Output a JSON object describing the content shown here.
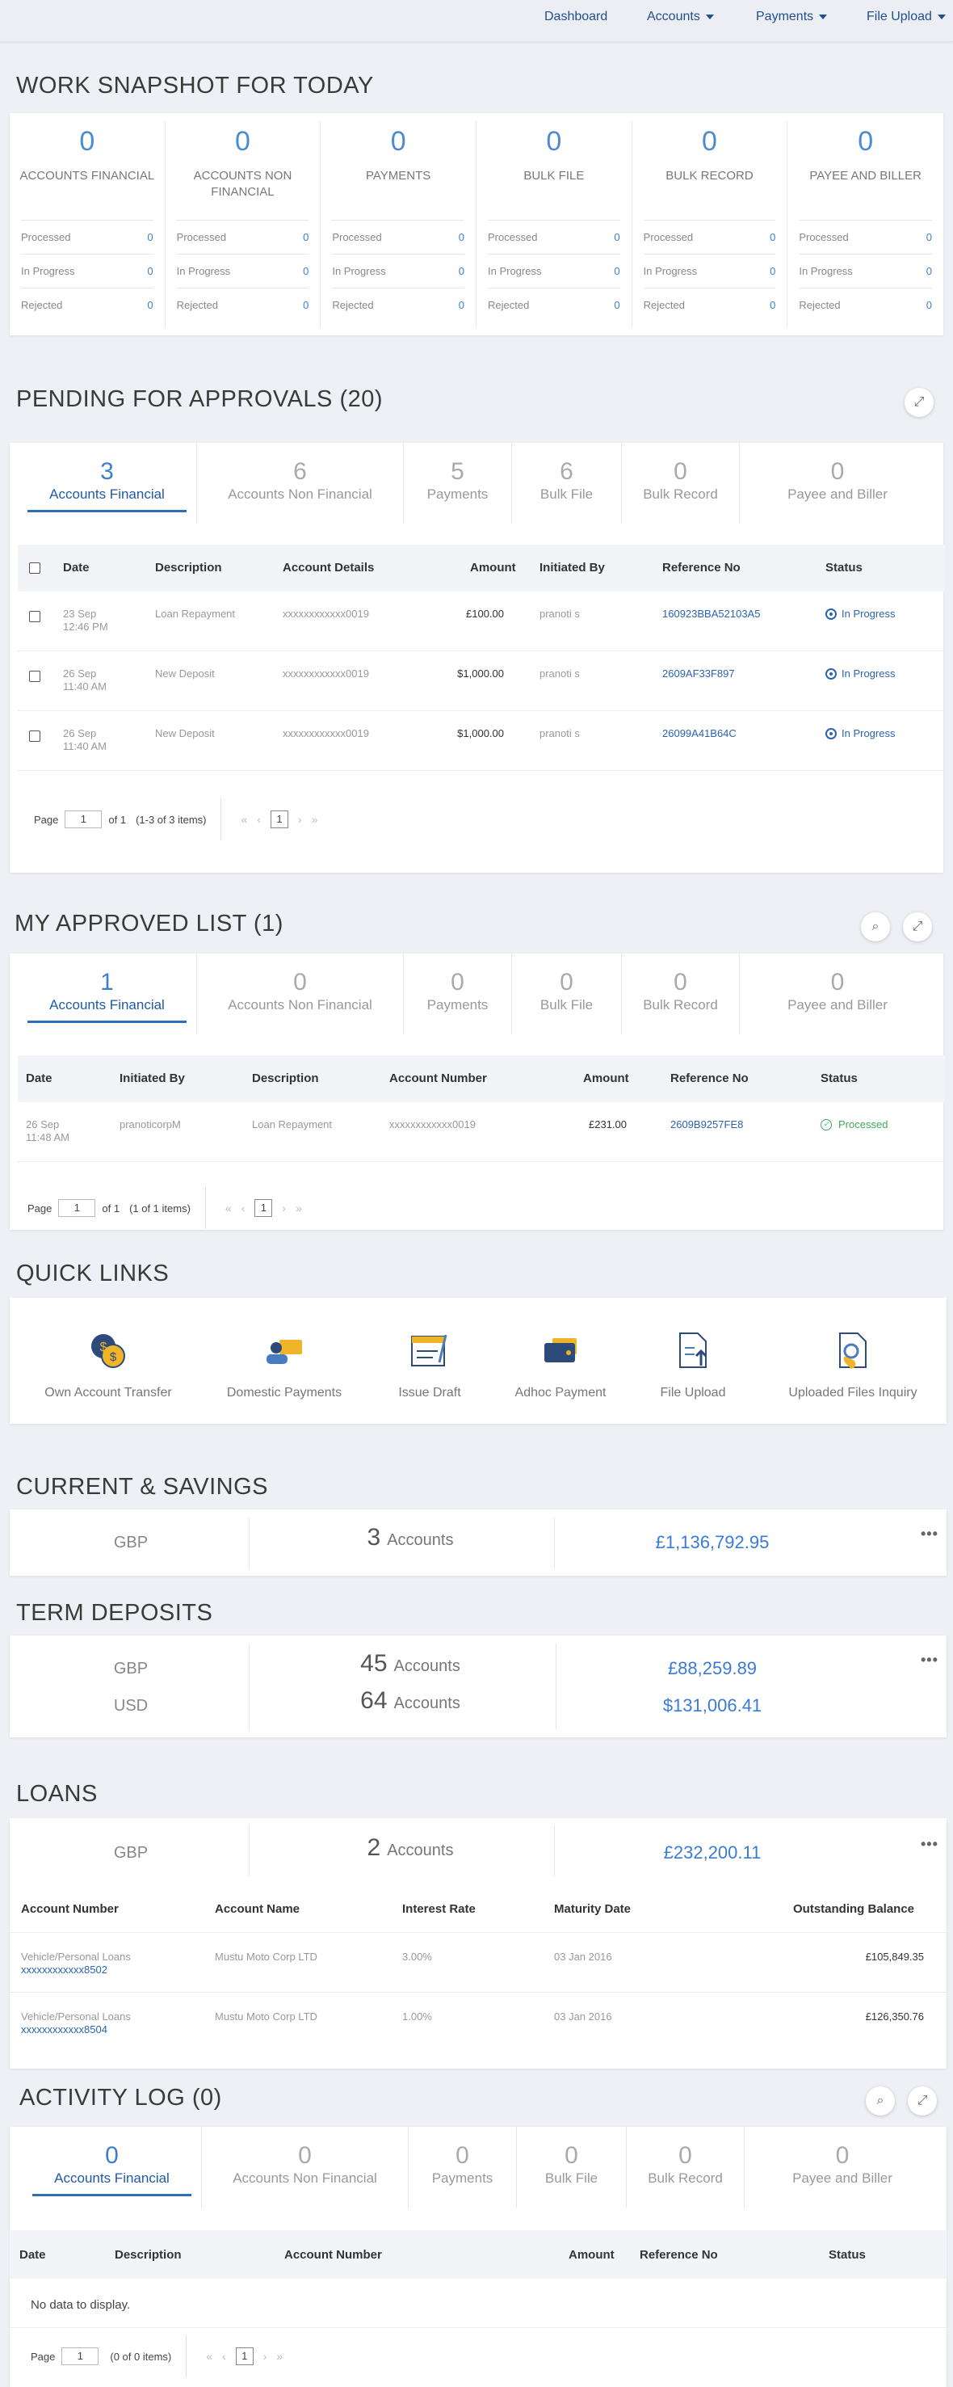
{
  "nav": {
    "dashboard": "Dashboard",
    "accounts": "Accounts",
    "payments": "Payments",
    "file_upload": "File Upload"
  },
  "snapshot": {
    "title": "WORK SNAPSHOT FOR TODAY",
    "row_labels": [
      "Processed",
      "In Progress",
      "Rejected"
    ],
    "columns": [
      {
        "count": "0",
        "label": "ACCOUNTS FINANCIAL",
        "values": [
          "0",
          "0",
          "0"
        ]
      },
      {
        "count": "0",
        "label": "ACCOUNTS NON FINANCIAL",
        "values": [
          "0",
          "0",
          "0"
        ]
      },
      {
        "count": "0",
        "label": "PAYMENTS",
        "values": [
          "0",
          "0",
          "0"
        ]
      },
      {
        "count": "0",
        "label": "BULK FILE",
        "values": [
          "0",
          "0",
          "0"
        ]
      },
      {
        "count": "0",
        "label": "BULK RECORD",
        "values": [
          "0",
          "0",
          "0"
        ]
      },
      {
        "count": "0",
        "label": "PAYEE AND BILLER",
        "values": [
          "0",
          "0",
          "0"
        ]
      }
    ]
  },
  "pending": {
    "title": "PENDING FOR APPROVALS (20)",
    "tabs": [
      {
        "count": "3",
        "label": "Accounts Financial"
      },
      {
        "count": "6",
        "label": "Accounts Non Financial"
      },
      {
        "count": "5",
        "label": "Payments"
      },
      {
        "count": "6",
        "label": "Bulk File"
      },
      {
        "count": "0",
        "label": "Bulk Record"
      },
      {
        "count": "0",
        "label": "Payee and Biller"
      }
    ],
    "headers": [
      "Date",
      "Description",
      "Account Details",
      "Amount",
      "Initiated By",
      "Reference No",
      "Status"
    ],
    "rows": [
      {
        "date1": "23 Sep",
        "date2": "12:46 PM",
        "desc": "Loan Repayment",
        "acct": "xxxxxxxxxxxx0019",
        "amount": "£100.00",
        "by": "pranoti s",
        "ref": "160923BBA52103A5",
        "status": "In Progress"
      },
      {
        "date1": "26 Sep",
        "date2": "11:40 AM",
        "desc": "New Deposit",
        "acct": "xxxxxxxxxxxx0019",
        "amount": "$1,000.00",
        "by": "pranoti s",
        "ref": "2609AF33F897",
        "status": "In Progress"
      },
      {
        "date1": "26 Sep",
        "date2": "11:40 AM",
        "desc": "New Deposit",
        "acct": "xxxxxxxxxxxx0019",
        "amount": "$1,000.00",
        "by": "pranoti s",
        "ref": "26099A41B64C",
        "status": "In Progress"
      }
    ],
    "pager": {
      "page_label": "Page",
      "page_value": "1",
      "of": "of 1",
      "items": "(1-3 of 3 items)",
      "current": "1"
    }
  },
  "approved": {
    "title": "MY APPROVED LIST (1)",
    "tabs": [
      {
        "count": "1",
        "label": "Accounts Financial"
      },
      {
        "count": "0",
        "label": "Accounts Non Financial"
      },
      {
        "count": "0",
        "label": "Payments"
      },
      {
        "count": "0",
        "label": "Bulk File"
      },
      {
        "count": "0",
        "label": "Bulk Record"
      },
      {
        "count": "0",
        "label": "Payee and Biller"
      }
    ],
    "headers": [
      "Date",
      "Initiated By",
      "Description",
      "Account Number",
      "Amount",
      "Reference No",
      "Status"
    ],
    "rows": [
      {
        "date1": "26 Sep",
        "date2": "11:48 AM",
        "by": "pranoticorpM",
        "desc": "Loan Repayment",
        "acct": "xxxxxxxxxxxx0019",
        "amount": "£231.00",
        "ref": "2609B9257FE8",
        "status": "Processed"
      }
    ],
    "pager": {
      "page_label": "Page",
      "page_value": "1",
      "of": "of 1",
      "items": "(1 of 1 items)",
      "current": "1"
    }
  },
  "quick_links": {
    "title": "QUICK LINKS",
    "items": [
      {
        "label": "Own Account Transfer",
        "icon": "coins-transfer-icon"
      },
      {
        "label": "Domestic Payments",
        "icon": "person-card-icon"
      },
      {
        "label": "Issue Draft",
        "icon": "draft-check-icon"
      },
      {
        "label": "Adhoc Payment",
        "icon": "wallet-icon"
      },
      {
        "label": "File Upload",
        "icon": "file-upload-icon"
      },
      {
        "label": "Uploaded Files Inquiry",
        "icon": "file-inquiry-icon"
      }
    ]
  },
  "casa": {
    "title": "CURRENT & SAVINGS",
    "currency": "GBP",
    "count": "3",
    "count_label": "Accounts",
    "balance": "£1,136,792.95"
  },
  "td": {
    "title": "TERM DEPOSITS",
    "rows": [
      {
        "currency": "GBP",
        "count": "45",
        "count_label": "Accounts",
        "balance": "£88,259.89"
      },
      {
        "currency": "USD",
        "count": "64",
        "count_label": "Accounts",
        "balance": "$131,006.41"
      }
    ]
  },
  "loans": {
    "title": "LOANS",
    "currency": "GBP",
    "count": "2",
    "count_label": "Accounts",
    "balance": "£232,200.11",
    "headers": [
      "Account Number",
      "Account Name",
      "Interest Rate",
      "Maturity Date",
      "Outstanding Balance"
    ],
    "rows": [
      {
        "type": "Vehicle/Personal Loans",
        "acct": "xxxxxxxxxxxx8502",
        "name": "Mustu Moto Corp LTD",
        "rate": "3.00%",
        "maturity": "03 Jan 2016",
        "balance": "£105,849.35"
      },
      {
        "type": "Vehicle/Personal Loans",
        "acct": "xxxxxxxxxxxx8504",
        "name": "Mustu Moto Corp LTD",
        "rate": "1.00%",
        "maturity": "03 Jan 2016",
        "balance": "£126,350.76"
      }
    ]
  },
  "activity": {
    "title": "ACTIVITY LOG (0)",
    "tabs": [
      {
        "count": "0",
        "label": "Accounts Financial"
      },
      {
        "count": "0",
        "label": "Accounts Non Financial"
      },
      {
        "count": "0",
        "label": "Payments"
      },
      {
        "count": "0",
        "label": "Bulk File"
      },
      {
        "count": "0",
        "label": "Bulk Record"
      },
      {
        "count": "0",
        "label": "Payee and Biller"
      }
    ],
    "headers": [
      "Date",
      "Description",
      "Account Number",
      "Amount",
      "Reference No",
      "Status"
    ],
    "empty": "No data to display.",
    "pager": {
      "page_label": "Page",
      "page_value": "1",
      "items": "(0 of 0 items)",
      "current": "1"
    }
  }
}
